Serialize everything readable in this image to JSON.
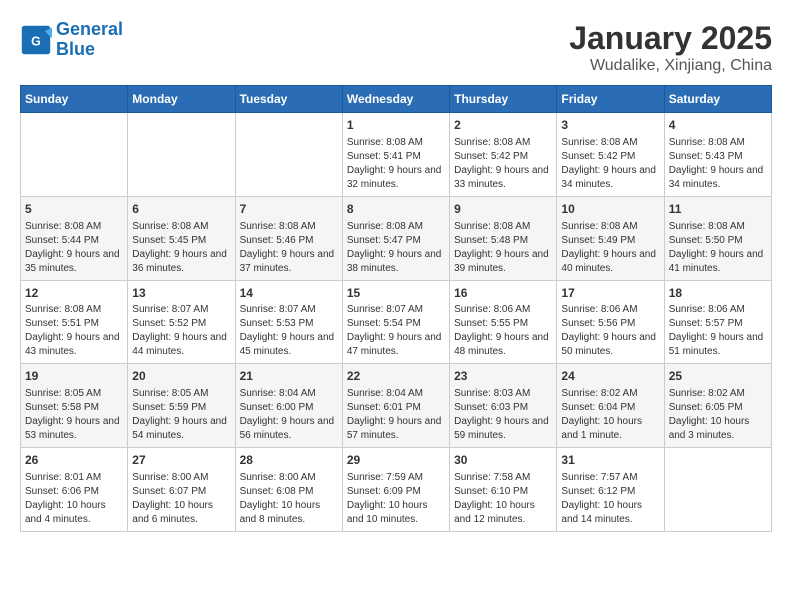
{
  "logo": {
    "line1": "General",
    "line2": "Blue"
  },
  "title": "January 2025",
  "subtitle": "Wudalike, Xinjiang, China",
  "weekdays": [
    "Sunday",
    "Monday",
    "Tuesday",
    "Wednesday",
    "Thursday",
    "Friday",
    "Saturday"
  ],
  "weeks": [
    [
      {
        "day": "",
        "info": ""
      },
      {
        "day": "",
        "info": ""
      },
      {
        "day": "",
        "info": ""
      },
      {
        "day": "1",
        "info": "Sunrise: 8:08 AM\nSunset: 5:41 PM\nDaylight: 9 hours and 32 minutes."
      },
      {
        "day": "2",
        "info": "Sunrise: 8:08 AM\nSunset: 5:42 PM\nDaylight: 9 hours and 33 minutes."
      },
      {
        "day": "3",
        "info": "Sunrise: 8:08 AM\nSunset: 5:42 PM\nDaylight: 9 hours and 34 minutes."
      },
      {
        "day": "4",
        "info": "Sunrise: 8:08 AM\nSunset: 5:43 PM\nDaylight: 9 hours and 34 minutes."
      }
    ],
    [
      {
        "day": "5",
        "info": "Sunrise: 8:08 AM\nSunset: 5:44 PM\nDaylight: 9 hours and 35 minutes."
      },
      {
        "day": "6",
        "info": "Sunrise: 8:08 AM\nSunset: 5:45 PM\nDaylight: 9 hours and 36 minutes."
      },
      {
        "day": "7",
        "info": "Sunrise: 8:08 AM\nSunset: 5:46 PM\nDaylight: 9 hours and 37 minutes."
      },
      {
        "day": "8",
        "info": "Sunrise: 8:08 AM\nSunset: 5:47 PM\nDaylight: 9 hours and 38 minutes."
      },
      {
        "day": "9",
        "info": "Sunrise: 8:08 AM\nSunset: 5:48 PM\nDaylight: 9 hours and 39 minutes."
      },
      {
        "day": "10",
        "info": "Sunrise: 8:08 AM\nSunset: 5:49 PM\nDaylight: 9 hours and 40 minutes."
      },
      {
        "day": "11",
        "info": "Sunrise: 8:08 AM\nSunset: 5:50 PM\nDaylight: 9 hours and 41 minutes."
      }
    ],
    [
      {
        "day": "12",
        "info": "Sunrise: 8:08 AM\nSunset: 5:51 PM\nDaylight: 9 hours and 43 minutes."
      },
      {
        "day": "13",
        "info": "Sunrise: 8:07 AM\nSunset: 5:52 PM\nDaylight: 9 hours and 44 minutes."
      },
      {
        "day": "14",
        "info": "Sunrise: 8:07 AM\nSunset: 5:53 PM\nDaylight: 9 hours and 45 minutes."
      },
      {
        "day": "15",
        "info": "Sunrise: 8:07 AM\nSunset: 5:54 PM\nDaylight: 9 hours and 47 minutes."
      },
      {
        "day": "16",
        "info": "Sunrise: 8:06 AM\nSunset: 5:55 PM\nDaylight: 9 hours and 48 minutes."
      },
      {
        "day": "17",
        "info": "Sunrise: 8:06 AM\nSunset: 5:56 PM\nDaylight: 9 hours and 50 minutes."
      },
      {
        "day": "18",
        "info": "Sunrise: 8:06 AM\nSunset: 5:57 PM\nDaylight: 9 hours and 51 minutes."
      }
    ],
    [
      {
        "day": "19",
        "info": "Sunrise: 8:05 AM\nSunset: 5:58 PM\nDaylight: 9 hours and 53 minutes."
      },
      {
        "day": "20",
        "info": "Sunrise: 8:05 AM\nSunset: 5:59 PM\nDaylight: 9 hours and 54 minutes."
      },
      {
        "day": "21",
        "info": "Sunrise: 8:04 AM\nSunset: 6:00 PM\nDaylight: 9 hours and 56 minutes."
      },
      {
        "day": "22",
        "info": "Sunrise: 8:04 AM\nSunset: 6:01 PM\nDaylight: 9 hours and 57 minutes."
      },
      {
        "day": "23",
        "info": "Sunrise: 8:03 AM\nSunset: 6:03 PM\nDaylight: 9 hours and 59 minutes."
      },
      {
        "day": "24",
        "info": "Sunrise: 8:02 AM\nSunset: 6:04 PM\nDaylight: 10 hours and 1 minute."
      },
      {
        "day": "25",
        "info": "Sunrise: 8:02 AM\nSunset: 6:05 PM\nDaylight: 10 hours and 3 minutes."
      }
    ],
    [
      {
        "day": "26",
        "info": "Sunrise: 8:01 AM\nSunset: 6:06 PM\nDaylight: 10 hours and 4 minutes."
      },
      {
        "day": "27",
        "info": "Sunrise: 8:00 AM\nSunset: 6:07 PM\nDaylight: 10 hours and 6 minutes."
      },
      {
        "day": "28",
        "info": "Sunrise: 8:00 AM\nSunset: 6:08 PM\nDaylight: 10 hours and 8 minutes."
      },
      {
        "day": "29",
        "info": "Sunrise: 7:59 AM\nSunset: 6:09 PM\nDaylight: 10 hours and 10 minutes."
      },
      {
        "day": "30",
        "info": "Sunrise: 7:58 AM\nSunset: 6:10 PM\nDaylight: 10 hours and 12 minutes."
      },
      {
        "day": "31",
        "info": "Sunrise: 7:57 AM\nSunset: 6:12 PM\nDaylight: 10 hours and 14 minutes."
      },
      {
        "day": "",
        "info": ""
      }
    ]
  ]
}
